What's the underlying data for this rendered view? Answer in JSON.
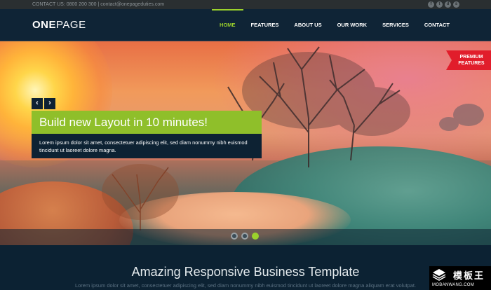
{
  "topbar": {
    "contact_text": "CONTACT US: 0800 200 300 | contact@onepageduties.com",
    "social": [
      {
        "icon": "facebook-icon",
        "glyph": "f"
      },
      {
        "icon": "twitter-icon",
        "glyph": "t"
      },
      {
        "icon": "dribbble-icon",
        "glyph": "d"
      },
      {
        "icon": "skype-icon",
        "glyph": "s"
      }
    ]
  },
  "header": {
    "logo_bold": "ONE",
    "logo_light": "PAGE",
    "nav": [
      {
        "label": "HOME",
        "active": true
      },
      {
        "label": "FEATURES",
        "active": false
      },
      {
        "label": "ABOUT US",
        "active": false
      },
      {
        "label": "OUR WORK",
        "active": false
      },
      {
        "label": "SERVICES",
        "active": false
      },
      {
        "label": "CONTACT",
        "active": false
      }
    ]
  },
  "hero": {
    "prev_arrow": "‹",
    "next_arrow": "›",
    "title": "Build new Layout in 10 minutes!",
    "text": "Lorem ipsum dolor sit amet, consectetuer adipiscing elit, sed diam nonummy nibh euismod tincidunt ut laoreet dolore magna.",
    "ribbon_line1": "PREMIUM",
    "ribbon_line2": "FEATURES",
    "slides": 3,
    "active_slide": 3
  },
  "section": {
    "heading": "Amazing Responsive Business Template",
    "subtext": "Lorem ipsum dolor sit amet, consectetuer adipiscing elit, sed diam nonummy nibh euismod tincidunt ut laoreet dolore magna aliquam erat volutpat."
  },
  "watermark": {
    "name": "模板王",
    "url": "MOBANWANG.COM"
  },
  "colors": {
    "accent": "#9bd12c",
    "navy": "#0f2436",
    "ribbon": "#e11d2b"
  }
}
